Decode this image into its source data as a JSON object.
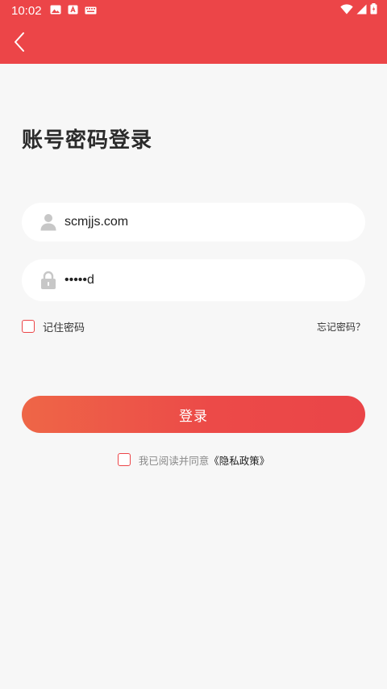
{
  "status_bar": {
    "time": "10:02",
    "left_icons": [
      "image-icon",
      "font-app-icon",
      "keyboard-icon"
    ],
    "right_icons": [
      "wifi-icon",
      "signal-icon",
      "battery-icon"
    ]
  },
  "colors": {
    "accent": "#ec4548",
    "button_gradient_start": "#ee6647",
    "button_gradient_end": "#ea4548",
    "background": "#f7f7f7"
  },
  "page": {
    "title": "账号密码登录"
  },
  "form": {
    "username_value": "scmjjs.com",
    "password_value": "•••••d",
    "remember_label": "记住密码",
    "forgot_label": "忘记密码？",
    "login_button": "登录"
  },
  "agreement": {
    "text": "我已阅读并同意",
    "policy_link": "《隐私政策》"
  }
}
